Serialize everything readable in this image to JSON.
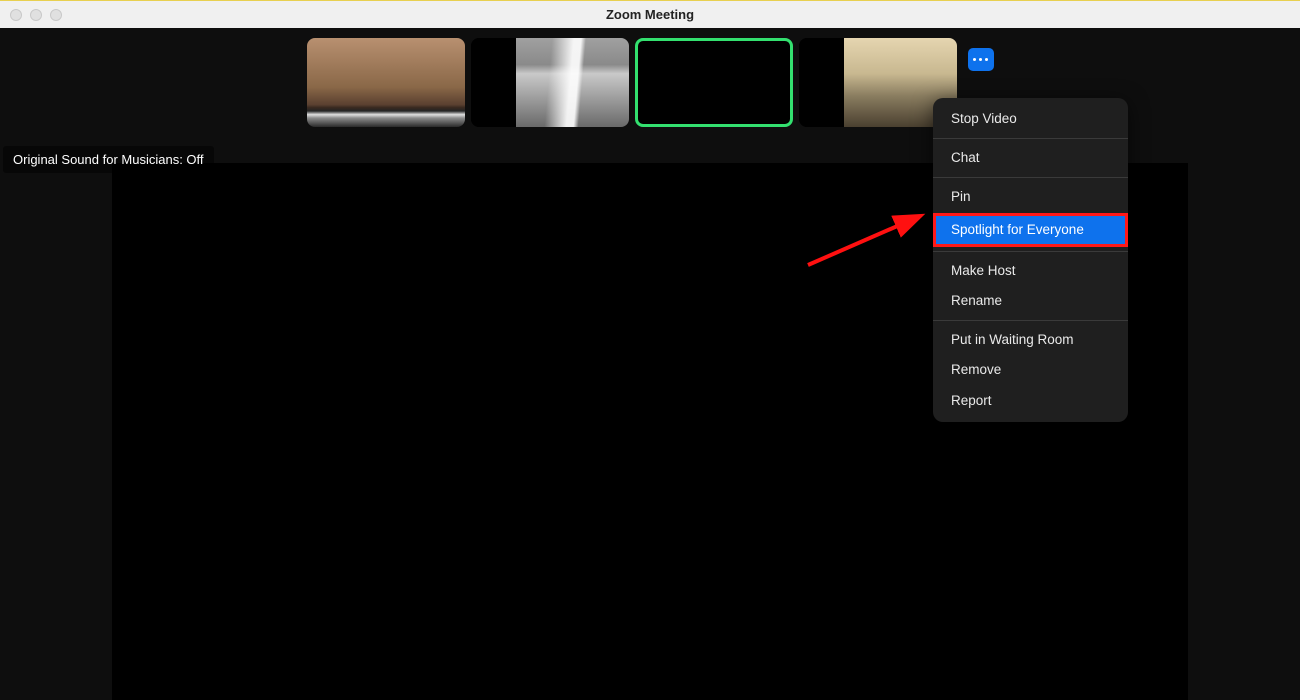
{
  "window": {
    "title": "Zoom Meeting"
  },
  "status": {
    "original_sound": "Original Sound for Musicians: Off"
  },
  "menu": {
    "group1": [
      "Stop Video"
    ],
    "group2": [
      "Chat"
    ],
    "group3": [
      "Pin",
      "Spotlight for Everyone"
    ],
    "group4": [
      "Make Host",
      "Rename"
    ],
    "group5": [
      "Put in Waiting Room",
      "Remove",
      "Report"
    ]
  },
  "highlighted_menu_item": "Spotlight for Everyone"
}
